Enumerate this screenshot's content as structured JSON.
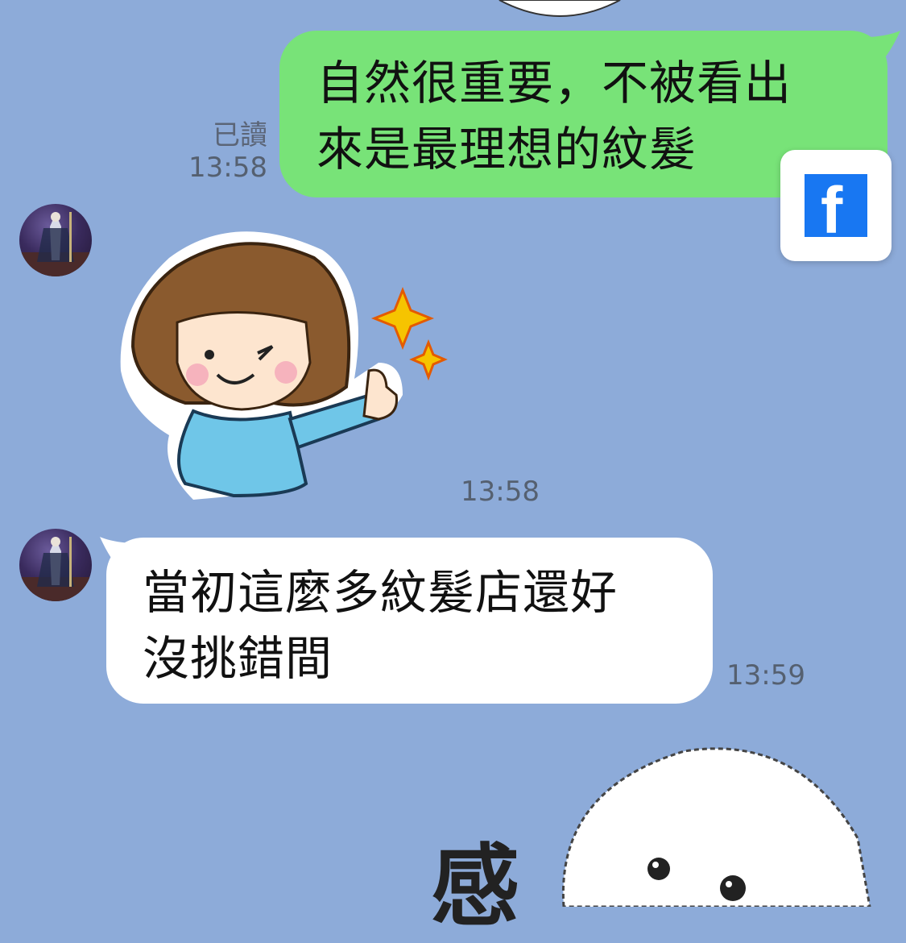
{
  "chat": {
    "messages": [
      {
        "side": "outgoing",
        "text": "自然很重要，不被看出\n來是最理想的紋髮",
        "read": "已讀",
        "time": "13:58"
      },
      {
        "side": "incoming",
        "type": "sticker",
        "sticker": "girl-thumbs-up-sticker",
        "time": "13:58"
      },
      {
        "side": "incoming",
        "text": "當初這麼多紋髮店還好\n沒挑錯間",
        "time": "13:59"
      },
      {
        "side": "incoming",
        "type": "sticker",
        "sticker": "white-dog-sticker",
        "text": "感"
      }
    ]
  },
  "share": {
    "icon": "facebook-icon",
    "letter": "f"
  },
  "colors": {
    "background": "#8dabd9",
    "outgoing_bubble": "#78e378",
    "incoming_bubble": "#ffffff",
    "facebook": "#1877f2"
  }
}
